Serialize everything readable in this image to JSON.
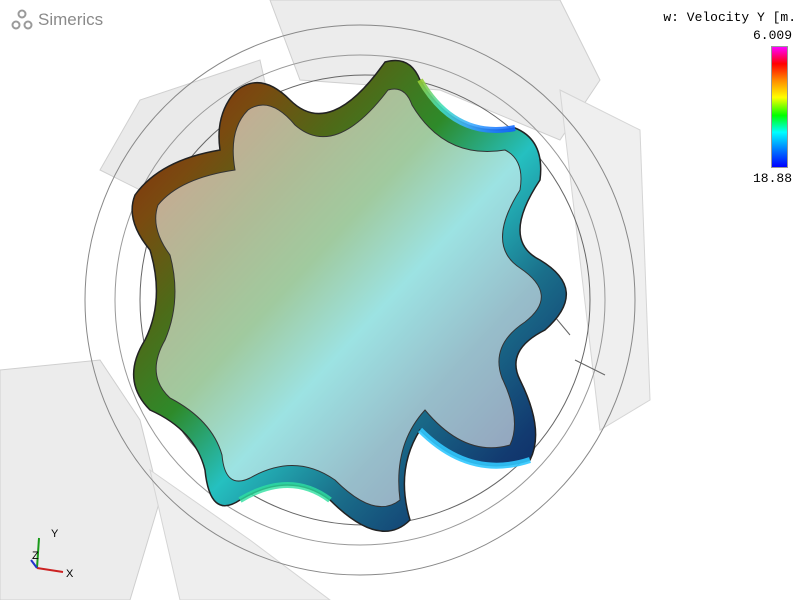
{
  "app": {
    "logo_text": "Simerics"
  },
  "legend": {
    "title": "w: Velocity Y [m.",
    "max_label": "6.009",
    "min_label": "18.88",
    "gradient_colors": [
      "#ff00ff",
      "#ff0000",
      "#ff8c00",
      "#ffff00",
      "#00ff00",
      "#00ffff",
      "#0080ff",
      "#0000ff"
    ]
  },
  "triad": {
    "y_label": "Y",
    "z_label": "Z",
    "x_label": "X"
  },
  "colors": {
    "background": "#ffffff",
    "housing": "#e6e6e6",
    "edge": "#555555"
  },
  "icons": {
    "logo": "simerics-logo-icon"
  }
}
